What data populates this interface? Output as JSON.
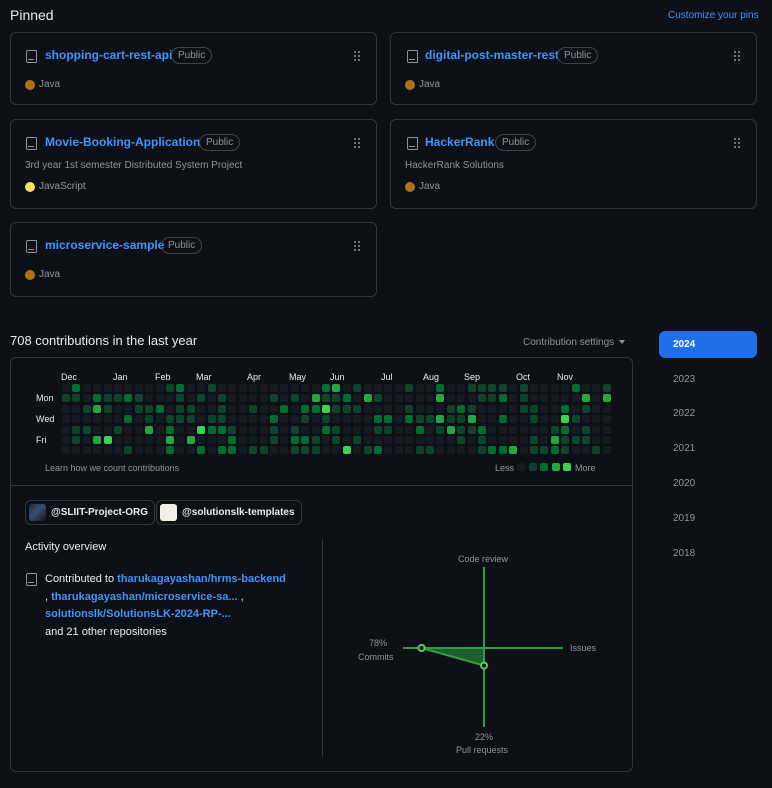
{
  "pinned": {
    "title": "Pinned",
    "customize_label": "Customize your pins",
    "repos": [
      {
        "name": "shopping-cart-rest-api",
        "visibility": "Public",
        "description": "",
        "language": "Java",
        "language_color": "#b07219"
      },
      {
        "name": "digital-post-master-rest",
        "visibility": "Public",
        "description": "",
        "language": "Java",
        "language_color": "#b07219"
      },
      {
        "name": "Movie-Booking-Application",
        "visibility": "Public",
        "description": "3rd year 1st semester Distributed System Project",
        "language": "JavaScript",
        "language_color": "#f1e05a"
      },
      {
        "name": "HackerRank",
        "visibility": "Public",
        "description": "HackerRank Solutions",
        "language": "Java",
        "language_color": "#b07219"
      },
      {
        "name": "microservice-sample",
        "visibility": "Public",
        "description": "",
        "language": "Java",
        "language_color": "#b07219"
      }
    ]
  },
  "contributions": {
    "title": "708 contributions in the last year",
    "settings_label": "Contribution settings",
    "months": [
      "Dec",
      "Jan",
      "Feb",
      "Mar",
      "Apr",
      "May",
      "Jun",
      "Jul",
      "Aug",
      "Sep",
      "Oct",
      "Nov"
    ],
    "days": [
      "Mon",
      "Wed",
      "Fri"
    ],
    "learn_label": "Learn how we count contributions",
    "legend_less": "Less",
    "legend_more": "More",
    "colors": [
      "#161b22",
      "#0e4429",
      "#006d32",
      "#26a641",
      "#39d353"
    ]
  },
  "orgs": [
    {
      "name": "@SLIIT-Project-ORG"
    },
    {
      "name": "@solutionslk-templates"
    }
  ],
  "activity": {
    "title": "Activity overview",
    "prefix": "Contributed to",
    "repo1": "tharukagayashan/hrms-backend",
    "sep1": ",",
    "repo2": "tharukagayashan/microservice-sa...",
    "sep2": ",",
    "repo3": "solutionslk/SolutionsLK-2024-RP-...",
    "suffix": "and 21 other repositories"
  },
  "activity_chart": {
    "code_review_label": "Code review",
    "issues_label": "Issues",
    "commits_pct": "78%",
    "commits_label": "Commits",
    "pr_pct": "22%",
    "pr_label": "Pull requests",
    "commits_value": 78,
    "pull_requests_value": 22,
    "code_review_value": 0,
    "issues_value": 0,
    "color": "#2ea043"
  },
  "years": [
    "2024",
    "2023",
    "2022",
    "2021",
    "2020",
    "2019",
    "2018"
  ]
}
